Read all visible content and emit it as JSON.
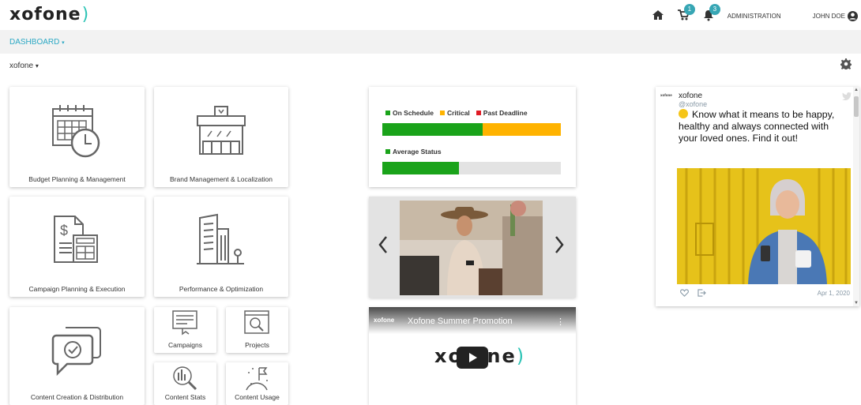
{
  "app": {
    "logo_text": "xofone",
    "logo_paren": ")",
    "accent_color": "#2ec4b6"
  },
  "header": {
    "home_icon": "home-icon",
    "cart_badge": "1",
    "bell_badge": "3",
    "admin_label": "ADMINISTRATION",
    "user_name": "JOHN DOE"
  },
  "subnav": {
    "dashboard_label": "DASHBOARD",
    "caret": "▾"
  },
  "breadcrumb": {
    "label": "xofone",
    "caret": "▾"
  },
  "tiles": [
    {
      "label": "Budget Planning & Management",
      "icon": "calendar-clock-icon"
    },
    {
      "label": "Brand Management & Localization",
      "icon": "storefront-icon"
    },
    {
      "label": "Campaign Planning & Execution",
      "icon": "invoice-calculator-icon"
    },
    {
      "label": "Performance & Optimization",
      "icon": "buildings-icon"
    },
    {
      "label": "Content Creation & Distribution",
      "icon": "chat-check-icon"
    },
    {
      "label": "Campaigns",
      "icon": "campaigns-icon"
    },
    {
      "label": "Projects",
      "icon": "projects-icon"
    },
    {
      "label": "Content Stats",
      "icon": "chart-magnifier-icon"
    },
    {
      "label": "Content Usage",
      "icon": "moon-flag-icon"
    }
  ],
  "status": {
    "legend": [
      {
        "label": "On Schedule",
        "color": "#1aa31a"
      },
      {
        "label": "Critical",
        "color": "#ffb300"
      },
      {
        "label": "Past Deadline",
        "color": "#e01b24"
      }
    ],
    "schedule_fractions": {
      "on_schedule": 0.56,
      "critical": 0.44,
      "past_deadline": 0
    },
    "average_label": "Average Status",
    "average_color": "#1aa31a",
    "average_fraction": 0.43
  },
  "carousel": {
    "prev_icon": "chevron-left-icon",
    "next_icon": "chevron-right-icon"
  },
  "video": {
    "channel_logo": "xofone",
    "title": "Xofone Summer Promotion",
    "menu": "⋮",
    "brand_text_a": "xof",
    "brand_text_b": "ne",
    "brand_paren": ")"
  },
  "tweet": {
    "mini_logo": "xofone",
    "account": "xofone",
    "handle": "@xofone",
    "text": "Know what it means to be happy, healthy and always connected with your loved ones. Find it out!",
    "date": "Apr 1, 2020",
    "like_icon": "heart-icon",
    "share_icon": "share-icon"
  }
}
